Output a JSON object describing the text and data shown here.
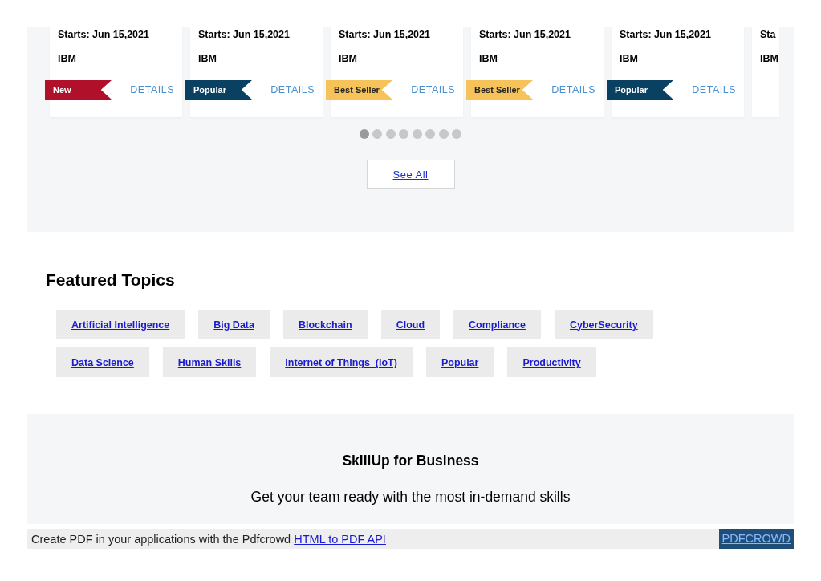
{
  "courses": [
    {
      "kind": "full",
      "start": "Starts: Jun 15,2021",
      "org": "IBM",
      "badge": {
        "label": "New",
        "kind": "new"
      },
      "details": "DETAILS"
    },
    {
      "kind": "full",
      "start": "Starts: Jun 15,2021",
      "org": "IBM",
      "badge": {
        "label": "Popular",
        "kind": "popular"
      },
      "details": "DETAILS"
    },
    {
      "kind": "full",
      "start": "Starts: Jun 15,2021",
      "org": "IBM",
      "badge": {
        "label": "Best Seller",
        "kind": "bestseller"
      },
      "details": "DETAILS"
    },
    {
      "kind": "full",
      "start": "Starts: Jun 15,2021",
      "org": "IBM",
      "badge": {
        "label": "Best Seller",
        "kind": "bestseller"
      },
      "details": "DETAILS"
    },
    {
      "kind": "full",
      "start": "Starts: Jun 15,2021",
      "org": "IBM",
      "badge": {
        "label": "Popular",
        "kind": "popular"
      },
      "details": "DETAILS"
    },
    {
      "kind": "partial",
      "start": "Sta",
      "org": "IBM"
    }
  ],
  "carousel_dots": [
    {
      "selected": true
    },
    {
      "selected": false
    },
    {
      "selected": false
    },
    {
      "selected": false
    },
    {
      "selected": false
    },
    {
      "selected": false
    },
    {
      "selected": false
    },
    {
      "selected": false
    }
  ],
  "see_all": "See All",
  "featured_topics": {
    "title": "Featured Topics",
    "rows": [
      [
        "Artificial Intelligence",
        "Big Data",
        "Blockchain",
        "Cloud",
        "Compliance",
        "CyberSecurity"
      ],
      [
        "Data Science",
        "Human Skills",
        "Internet of Things  (IoT)",
        "Popular",
        "Productivity"
      ]
    ]
  },
  "business": {
    "title": "SkillUp for Business",
    "subtitle": "Get your team ready with the most in-demand skills"
  },
  "footer": {
    "text": "Create PDF in your applications with the Pdfcrowd",
    "link": "HTML to PDF API",
    "brand": "PDFCROWD"
  }
}
